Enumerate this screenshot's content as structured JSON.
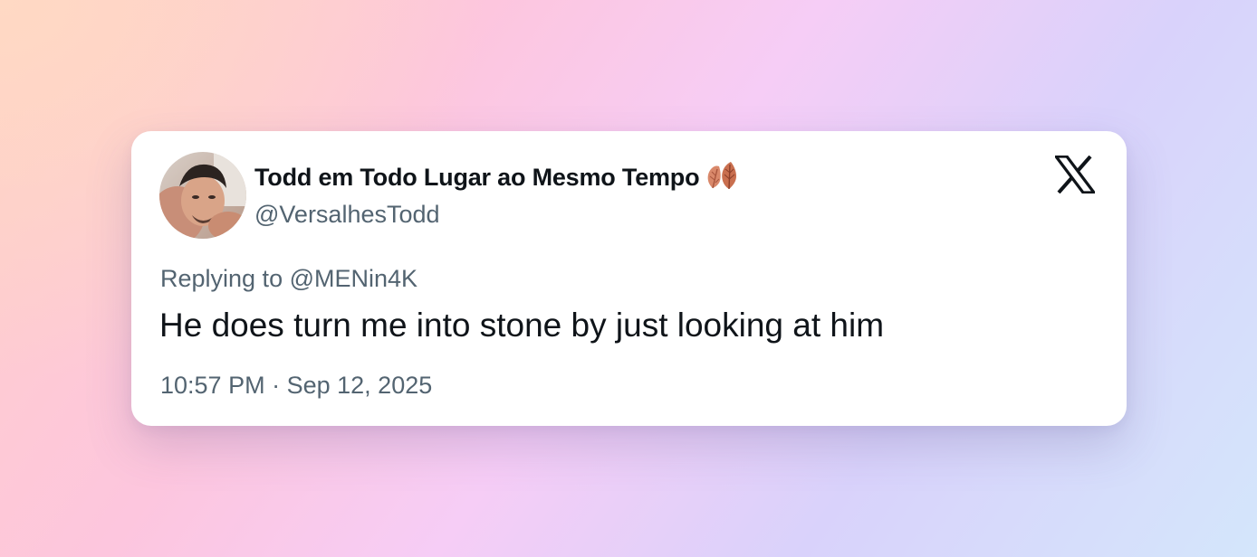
{
  "tweet": {
    "author": {
      "display_name": "Todd em Todo Lugar ao Mesmo Tempo",
      "name_emoji": "leaf-emoji",
      "handle": "@VersalhesTodd",
      "avatar": "profile-photo"
    },
    "reply": {
      "prefix": "Replying to",
      "mention": "@MENin4K"
    },
    "text": "He does turn me into stone by just looking at him",
    "time": "10:57 PM",
    "separator": "·",
    "date": "Sep 12, 2025",
    "platform_icon": "x-logo-icon"
  },
  "colors": {
    "text_primary": "#0f1419",
    "text_secondary": "#536471",
    "card_background": "#ffffff"
  }
}
